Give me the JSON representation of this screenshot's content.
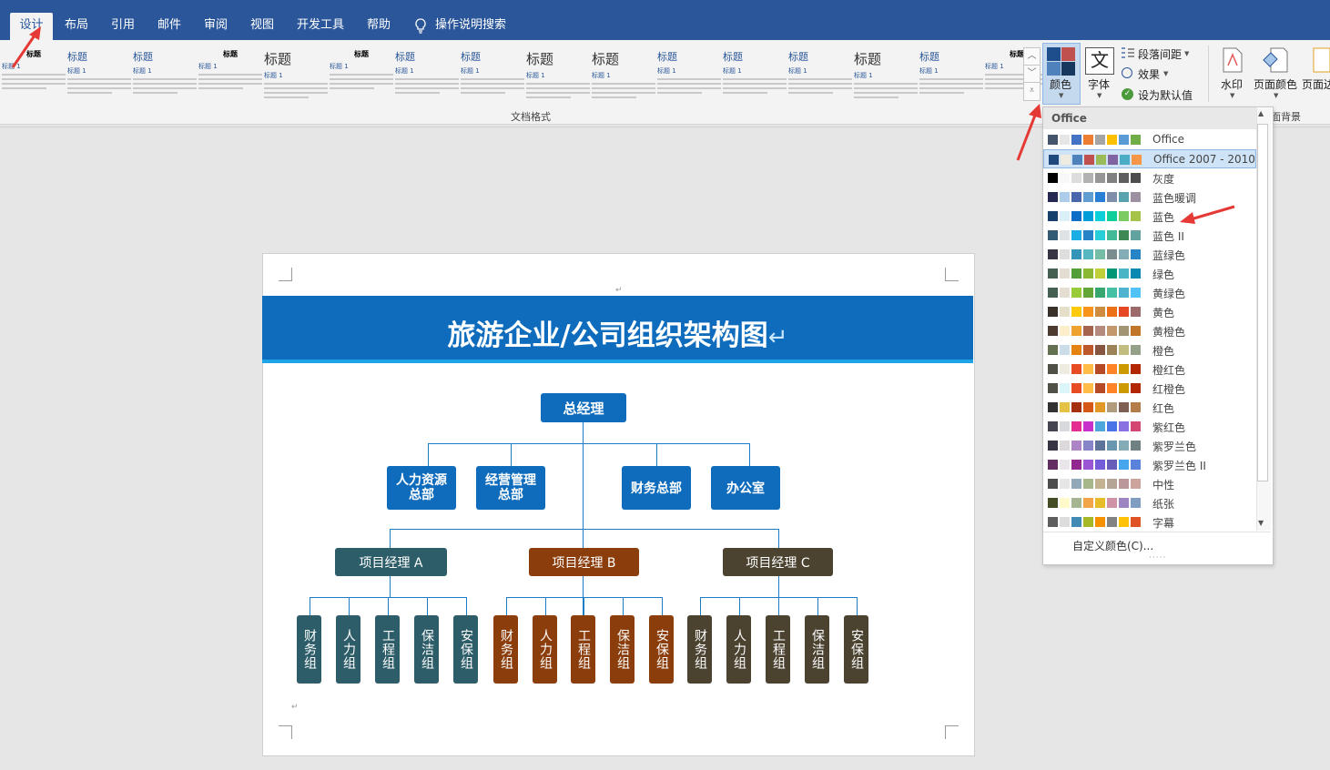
{
  "tabs": [
    "设计",
    "布局",
    "引用",
    "邮件",
    "审阅",
    "视图",
    "开发工具",
    "帮助",
    "操作说明搜索"
  ],
  "active_tab": "设计",
  "ribbon": {
    "gallery_title": "标题",
    "gallery_heading1": "标题 1",
    "group_label": "文档格式",
    "colors_label": "颜色",
    "fonts_label": "字体",
    "paragraph_spacing": "段落间距",
    "effects": "效果",
    "set_default": "设为默认值",
    "watermark": "水印",
    "page_color": "页面颜色",
    "page_border": "页面边",
    "page_bg_label": "面背景"
  },
  "doc": {
    "title": "旅游企业/公司组织架构图",
    "ceo": "总经理",
    "dept1": "人力资源\n总部",
    "dept2": "经营管理\n总部",
    "dept3": "财务总部",
    "dept4": "办公室",
    "pm_a": "项目经理 A",
    "pm_b": "项目经理 B",
    "pm_c": "项目经理 C",
    "teams": [
      "财务组",
      "人力组",
      "工程组",
      "保洁组",
      "安保组"
    ]
  },
  "dropdown": {
    "header": "Office",
    "custom": "自定义颜色(C)...",
    "selected_index": 1,
    "themes": [
      {
        "name": "Office",
        "colors": [
          "#44546a",
          "#e7e6e6",
          "#4472c4",
          "#ed7d31",
          "#a5a5a5",
          "#ffc000",
          "#5b9bd5",
          "#70ad47"
        ]
      },
      {
        "name": "Office 2007 - 2010",
        "colors": [
          "#1f497d",
          "#eeece1",
          "#4f81bd",
          "#c0504d",
          "#9bbb59",
          "#8064a2",
          "#4bacc6",
          "#f79646"
        ]
      },
      {
        "name": "灰度",
        "colors": [
          "#000000",
          "#f8f8f8",
          "#dddddd",
          "#b2b2b2",
          "#969696",
          "#808080",
          "#5f5f5f",
          "#4d4d4d"
        ]
      },
      {
        "name": "蓝色暖调",
        "colors": [
          "#242852",
          "#acccea",
          "#4a66ac",
          "#629dd1",
          "#297fd5",
          "#7f8fa9",
          "#5aa2ae",
          "#9d90a0"
        ]
      },
      {
        "name": "蓝色",
        "colors": [
          "#17406d",
          "#dbeff9",
          "#0f6fc6",
          "#009dd9",
          "#0bd0d9",
          "#10cf9b",
          "#7cca62",
          "#a5c249"
        ]
      },
      {
        "name": "蓝色 II",
        "colors": [
          "#335b74",
          "#dfe3e5",
          "#1cade4",
          "#2683c6",
          "#27ced7",
          "#42ba97",
          "#3e8853",
          "#62a39f"
        ]
      },
      {
        "name": "蓝绿色",
        "colors": [
          "#373545",
          "#dedede",
          "#3494ba",
          "#58b6c0",
          "#75bda7",
          "#7a8c8e",
          "#84acb6",
          "#2683c6"
        ]
      },
      {
        "name": "绿色",
        "colors": [
          "#455f51",
          "#e3ded1",
          "#549e39",
          "#8ab833",
          "#c0cf3a",
          "#029676",
          "#4ab5c4",
          "#0989b1"
        ]
      },
      {
        "name": "黄绿色",
        "colors": [
          "#455f51",
          "#e3ded1",
          "#99cb38",
          "#63a537",
          "#37a76f",
          "#44c1a3",
          "#4eb3cf",
          "#51c3f9"
        ]
      },
      {
        "name": "黄色",
        "colors": [
          "#39302a",
          "#e5dec9",
          "#ffca08",
          "#f8931d",
          "#ce8d3e",
          "#ec7016",
          "#e64823",
          "#9c6a6a"
        ]
      },
      {
        "name": "黄橙色",
        "colors": [
          "#4e3b30",
          "#fbeec9",
          "#f0a22e",
          "#a5644e",
          "#b58b80",
          "#c3986d",
          "#a19574",
          "#c17529"
        ]
      },
      {
        "name": "橙色",
        "colors": [
          "#637052",
          "#ccddea",
          "#e48312",
          "#bd582c",
          "#865640",
          "#9b8357",
          "#c2bc80",
          "#94a088"
        ]
      },
      {
        "name": "橙红色",
        "colors": [
          "#505046",
          "#eeece1",
          "#e84c22",
          "#ffbd47",
          "#b64926",
          "#ff8427",
          "#cc9900",
          "#b22600"
        ]
      },
      {
        "name": "红橙色",
        "colors": [
          "#505046",
          "#dbf5f9",
          "#e84c22",
          "#ffbd47",
          "#b64926",
          "#ff8427",
          "#cc9900",
          "#b22600"
        ]
      },
      {
        "name": "红色",
        "colors": [
          "#323232",
          "#e5c243",
          "#a5300f",
          "#d55816",
          "#e19825",
          "#b19c7d",
          "#7f5f52",
          "#b27d49"
        ]
      },
      {
        "name": "紫红色",
        "colors": [
          "#454551",
          "#d8d9dc",
          "#e32d91",
          "#c830cc",
          "#4ea6dc",
          "#4775e7",
          "#8971e1",
          "#d54773"
        ]
      },
      {
        "name": "紫罗兰色",
        "colors": [
          "#373545",
          "#dcd8dc",
          "#ad84c6",
          "#8784c7",
          "#5d739a",
          "#6997af",
          "#84acb6",
          "#6f8183"
        ]
      },
      {
        "name": "紫罗兰色 II",
        "colors": [
          "#632e62",
          "#eae5eb",
          "#92278f",
          "#9b57d3",
          "#755dd9",
          "#665eb8",
          "#45a5ed",
          "#5982db"
        ]
      },
      {
        "name": "中性",
        "colors": [
          "#4d4d4d",
          "#e6e6e6",
          "#92a9b9",
          "#a7b789",
          "#c3b18f",
          "#b4a597",
          "#ba9799",
          "#cda39d"
        ]
      },
      {
        "name": "纸张",
        "colors": [
          "#444d26",
          "#fefac9",
          "#a5b592",
          "#f3a447",
          "#e7bc29",
          "#d092a7",
          "#9c85c0",
          "#809ec2"
        ]
      },
      {
        "name": "字幕",
        "colors": [
          "#5e5e5e",
          "#dddddd",
          "#418ab3",
          "#a6b727",
          "#f69200",
          "#838383",
          "#fec306",
          "#df5327"
        ]
      }
    ]
  }
}
